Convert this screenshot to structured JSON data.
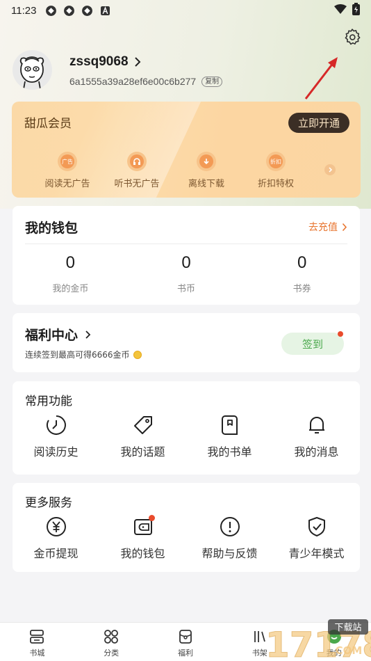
{
  "status_bar": {
    "time": "11:23"
  },
  "profile": {
    "username": "zssq9068",
    "user_id": "6a1555a39a28ef6e00c6b277",
    "copy_label": "复制"
  },
  "vip": {
    "title": "甜瓜会员",
    "button": "立即开通",
    "perks": [
      {
        "label": "阅读无广告",
        "icon": "no-ads-icon",
        "icon_text": "广告"
      },
      {
        "label": "听书无广告",
        "icon": "headphone-icon",
        "icon_text": ""
      },
      {
        "label": "离线下载",
        "icon": "download-icon",
        "icon_text": ""
      },
      {
        "label": "折扣特权",
        "icon": "discount-icon",
        "icon_text": "折扣"
      }
    ]
  },
  "wallet": {
    "title": "我的钱包",
    "recharge": "去充值",
    "stats": [
      {
        "value": "0",
        "label": "我的金币"
      },
      {
        "value": "0",
        "label": "书币"
      },
      {
        "value": "0",
        "label": "书券"
      }
    ]
  },
  "welfare": {
    "title": "福利中心",
    "subtitle": "连续签到最高可得6666金币",
    "signin": "签到"
  },
  "common": {
    "title": "常用功能",
    "items": [
      {
        "label": "阅读历史",
        "icon": "history-icon"
      },
      {
        "label": "我的话题",
        "icon": "tag-icon"
      },
      {
        "label": "我的书单",
        "icon": "booklist-icon"
      },
      {
        "label": "我的消息",
        "icon": "bell-icon"
      }
    ]
  },
  "more": {
    "title": "更多服务",
    "items": [
      {
        "label": "金币提现",
        "icon": "yuan-icon"
      },
      {
        "label": "我的钱包",
        "icon": "wallet-icon"
      },
      {
        "label": "帮助与反馈",
        "icon": "help-icon"
      },
      {
        "label": "青少年模式",
        "icon": "shield-icon"
      }
    ]
  },
  "tabs": [
    {
      "label": "书城",
      "icon": "bookstore-icon"
    },
    {
      "label": "分类",
      "icon": "category-icon"
    },
    {
      "label": "福利",
      "icon": "welfare-icon"
    },
    {
      "label": "书架",
      "icon": "bookshelf-icon"
    },
    {
      "label": "我的",
      "icon": "profile-icon"
    }
  ],
  "watermark": {
    "text": "17178",
    "badge": "下载站",
    "domain": "COM"
  },
  "colors": {
    "accent": "#e8752f",
    "green": "#4aa84c",
    "vip_dark": "#3b2e25"
  }
}
